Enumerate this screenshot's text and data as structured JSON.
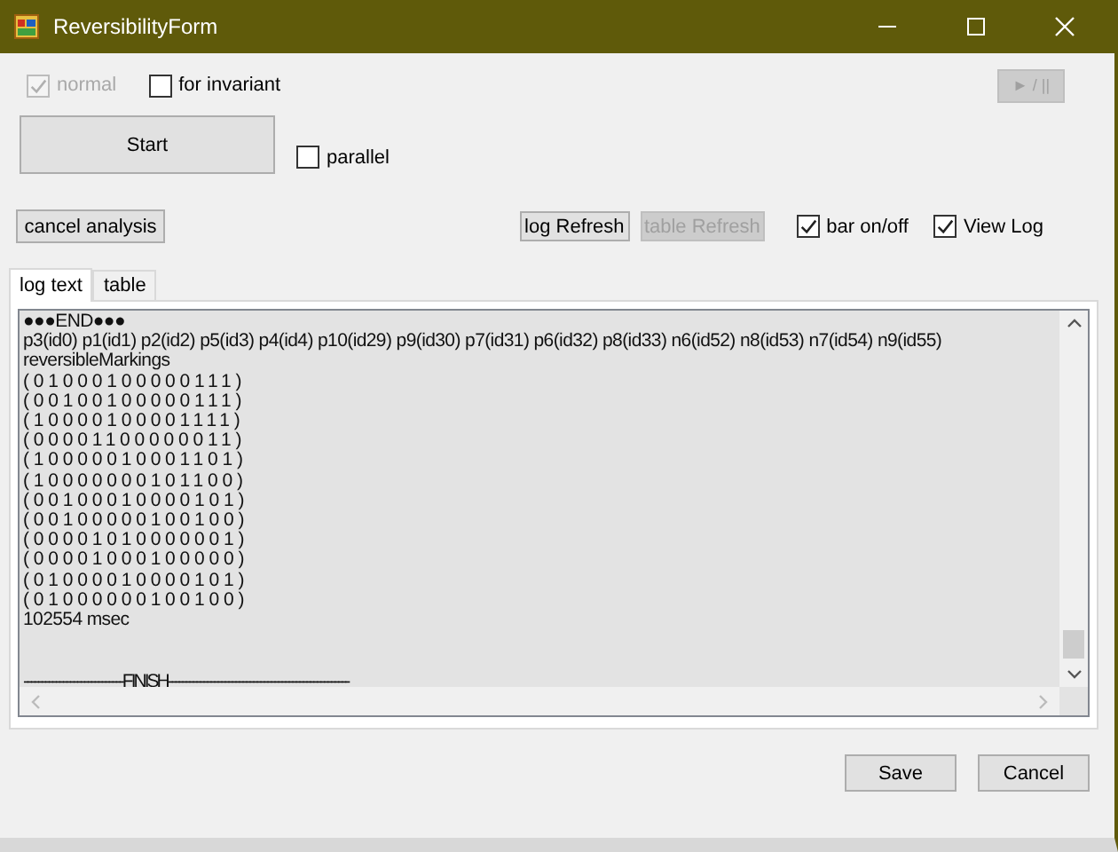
{
  "window": {
    "title": "ReversibilityForm"
  },
  "row1": {
    "checkboxes": [
      {
        "label": "normal",
        "checked": true,
        "disabled": true
      },
      {
        "label": "for invariant",
        "checked": false,
        "disabled": false
      }
    ],
    "play_button": {
      "label": "► / ||",
      "disabled": true
    }
  },
  "row2": {
    "start_button": {
      "label": "Start",
      "disabled": false
    },
    "parallel": {
      "label": "parallel",
      "checked": false,
      "disabled": false
    }
  },
  "row3": {
    "cancel_button": {
      "label": "cancel analysis",
      "disabled": false
    },
    "buttons": [
      {
        "label": "log Refresh",
        "disabled": false
      },
      {
        "label": "table Refresh",
        "disabled": true
      }
    ],
    "checkboxes": [
      {
        "label": "bar on/off",
        "checked": true,
        "disabled": false
      },
      {
        "label": "View Log",
        "checked": true,
        "disabled": false
      }
    ]
  },
  "tabs": [
    {
      "label": "log text",
      "selected": true
    },
    {
      "label": "table",
      "selected": false
    }
  ],
  "log": [
    {
      "kind": "text",
      "text": "●●●END●●●"
    },
    {
      "kind": "text",
      "text": "p3(id0) p1(id1) p2(id2) p5(id3) p4(id4) p10(id29) p9(id30) p7(id31) p6(id32) p8(id33) n6(id52) n8(id53) n7(id54) n9(id55)"
    },
    {
      "kind": "text",
      "text": "reversibleMarkings"
    },
    {
      "kind": "marking",
      "text": "(01000100000111)"
    },
    {
      "kind": "marking",
      "text": "(00100100000111)"
    },
    {
      "kind": "marking",
      "text": "(10000100001111)"
    },
    {
      "kind": "marking",
      "text": "(00001100000011)"
    },
    {
      "kind": "marking",
      "text": "(10000010001101)"
    },
    {
      "kind": "marking",
      "text": "(10000000101100)"
    },
    {
      "kind": "marking",
      "text": "(00100010000101)"
    },
    {
      "kind": "marking",
      "text": "(00100000100100)"
    },
    {
      "kind": "marking",
      "text": "(00001010000001)"
    },
    {
      "kind": "marking",
      "text": "(00001000100000)"
    },
    {
      "kind": "marking",
      "text": "(01000010000101)"
    },
    {
      "kind": "marking",
      "text": "(01000000100100)"
    },
    {
      "kind": "text",
      "text": "102554 msec"
    },
    {
      "kind": "rule",
      "text": "----------------------------FINISH---------------------------------------------------"
    }
  ],
  "footer": {
    "buttons": [
      {
        "label": "Save",
        "disabled": false
      },
      {
        "label": "Cancel",
        "disabled": false
      }
    ]
  }
}
